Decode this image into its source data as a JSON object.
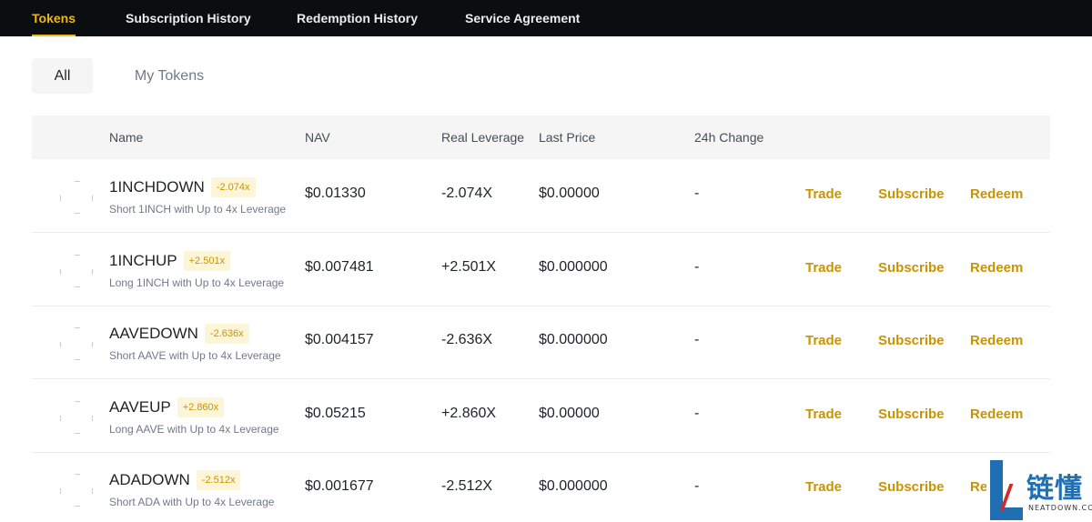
{
  "nav": {
    "tabs": [
      {
        "label": "Tokens",
        "active": true
      },
      {
        "label": "Subscription History",
        "active": false
      },
      {
        "label": "Redemption History",
        "active": false
      },
      {
        "label": "Service Agreement",
        "active": false
      }
    ]
  },
  "filters": {
    "all": "All",
    "my_tokens": "My Tokens",
    "selected": "All"
  },
  "table": {
    "headers": {
      "name": "Name",
      "nav": "NAV",
      "real_leverage": "Real Leverage",
      "last_price": "Last Price",
      "change_24h": "24h Change"
    },
    "rows": [
      {
        "symbol": "1INCHDOWN",
        "badge": "-2.074x",
        "desc": "Short 1INCH with Up to 4x Leverage",
        "nav": "$0.01330",
        "leverage": "-2.074X",
        "last_price": "$0.00000",
        "change": "-",
        "trade": "Trade",
        "subscribe": "Subscribe",
        "redeem": "Redeem"
      },
      {
        "symbol": "1INCHUP",
        "badge": "+2.501x",
        "desc": "Long 1INCH with Up to 4x Leverage",
        "nav": "$0.007481",
        "leverage": "+2.501X",
        "last_price": "$0.000000",
        "change": "-",
        "trade": "Trade",
        "subscribe": "Subscribe",
        "redeem": "Redeem"
      },
      {
        "symbol": "AAVEDOWN",
        "badge": "-2.636x",
        "desc": "Short AAVE with Up to 4x Leverage",
        "nav": "$0.004157",
        "leverage": "-2.636X",
        "last_price": "$0.000000",
        "change": "-",
        "trade": "Trade",
        "subscribe": "Subscribe",
        "redeem": "Redeem"
      },
      {
        "symbol": "AAVEUP",
        "badge": "+2.860x",
        "desc": "Long AAVE with Up to 4x Leverage",
        "nav": "$0.05215",
        "leverage": "+2.860X",
        "last_price": "$0.00000",
        "change": "-",
        "trade": "Trade",
        "subscribe": "Subscribe",
        "redeem": "Redeem"
      },
      {
        "symbol": "ADADOWN",
        "badge": "-2.512x",
        "desc": "Short ADA with Up to 4x Leverage",
        "nav": "$0.001677",
        "leverage": "-2.512X",
        "last_price": "$0.000000",
        "change": "-",
        "trade": "Trade",
        "subscribe": "Subscribe",
        "redeem": "Redeem"
      }
    ]
  },
  "watermark": {
    "cn_text": "链懂",
    "en_text": "NEATDOWN.COM"
  },
  "colors": {
    "accent": "#f0b90b",
    "action_gold": "#c99400",
    "badge_bg": "#fdf5d8",
    "nav_bg": "#0b0e11",
    "header_bg": "#f5f5f5"
  }
}
